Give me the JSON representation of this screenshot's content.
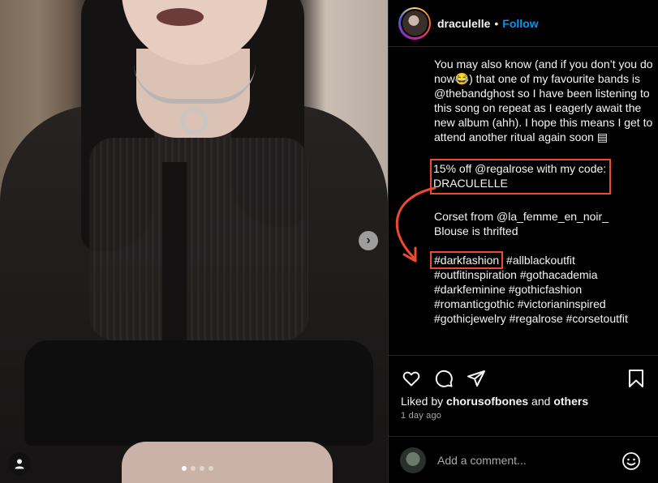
{
  "post": {
    "username": "draculelle",
    "separator": "•",
    "follow_label": "Follow"
  },
  "caption": {
    "para1_a": "You may also know (and if you don’t you do now",
    "para1_emoji": "😂",
    "para1_b": ") that one of my favourite bands is @thebandghost so I have been listening to this song on repeat as I eagerly await the new album (ahh). I hope this means I get to attend another ritual again soon ",
    "para1_emoji2": "▤",
    "code_line1": "15% off @regalrose with my code:",
    "code_line2": "DRACULELLE",
    "corset": "Corset from @la_femme_en_noir_",
    "blouse": "Blouse is thrifted",
    "tag_highlight": "#darkfashion",
    "tags_rest": " #allblackoutfit #outfitinspiration #gothacademia #darkfeminine #gothicfashion #romanticgothic #victorianinspired #gothicjewelry #regalrose #corsetoutfit"
  },
  "likes": {
    "prefix": "Liked by ",
    "user": "chorusofbones",
    "middle": " and ",
    "others": "others"
  },
  "time_ago": "1 day ago",
  "comment": {
    "placeholder": "Add a comment..."
  },
  "icons": {
    "like": "heart-icon",
    "comment": "comment-icon",
    "share": "share-icon",
    "save": "bookmark-icon",
    "emoji": "emoji-icon",
    "next": "chevron-right-icon",
    "tag": "user-tag-icon"
  },
  "colors": {
    "follow": "#0095f6",
    "highlight": "#ee4a2e",
    "background": "#000000"
  },
  "carousel": {
    "slides": 4,
    "active_index": 0
  }
}
